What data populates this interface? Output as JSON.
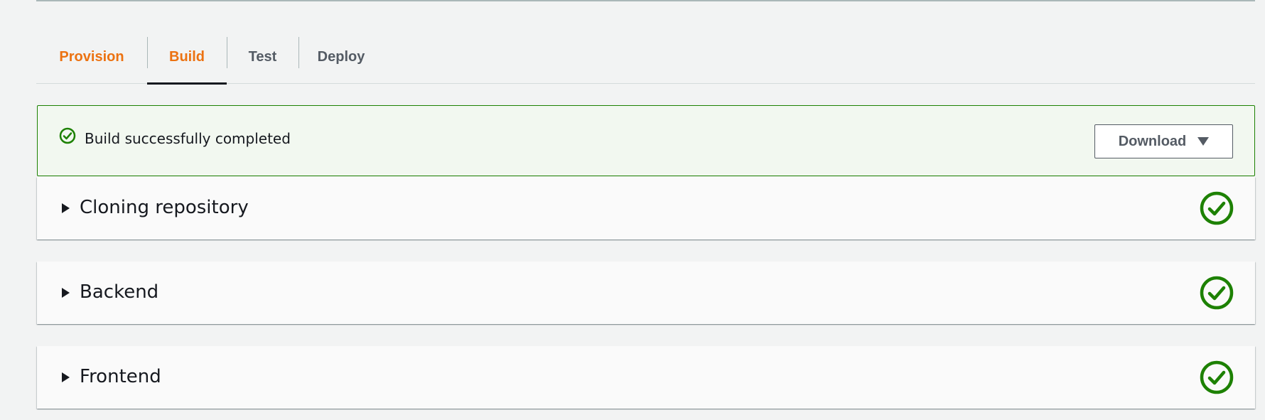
{
  "colors": {
    "accent": "#ec7211",
    "success": "#1d8102",
    "text": "#16191f",
    "muted": "#545b64",
    "background": "#f2f3f3"
  },
  "tabs": [
    {
      "label": "Provision",
      "state": "completed"
    },
    {
      "label": "Build",
      "state": "active"
    },
    {
      "label": "Test",
      "state": "pending"
    },
    {
      "label": "Deploy",
      "state": "pending"
    }
  ],
  "flash": {
    "icon": "check-circle-icon",
    "message": "Build successfully completed",
    "download_label": "Download"
  },
  "sections": [
    {
      "title": "Cloning repository",
      "status": "success",
      "icon": "check-circle-icon"
    },
    {
      "title": "Backend",
      "status": "success",
      "icon": "check-circle-icon"
    },
    {
      "title": "Frontend",
      "status": "success",
      "icon": "check-circle-icon"
    }
  ]
}
